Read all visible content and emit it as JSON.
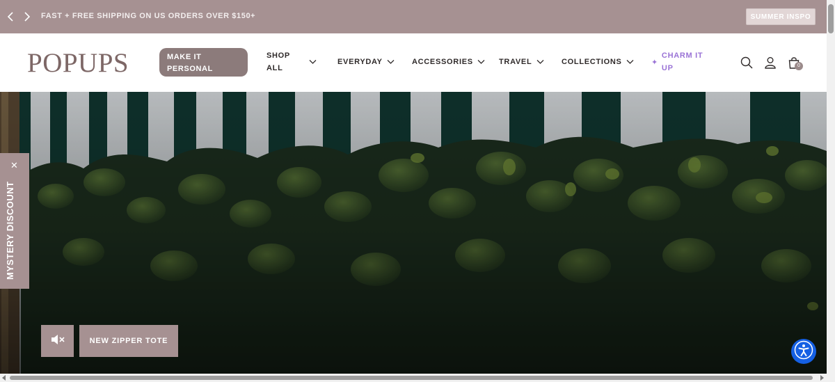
{
  "announcement": {
    "message": "FAST + FREE SHIPPING ON US ORDERS OVER $150+",
    "prev_icon": "chevron-left-icon",
    "next_icon": "chevron-right-icon",
    "cta_label": "SUMMER INSPO",
    "bg_color": "#a69192"
  },
  "header": {
    "logo": "POPUPS",
    "personal_label": "MAKE IT PERSONAL",
    "nav": [
      {
        "label": "SHOP ALL"
      },
      {
        "label": "EVERYDAY"
      },
      {
        "label": "ACCESSORIES"
      },
      {
        "label": "TRAVEL"
      },
      {
        "label": "COLLECTIONS"
      }
    ],
    "charm_label": "CHARM IT UP",
    "charm_color": "#9a73d6",
    "icons": [
      "search-icon",
      "account-icon",
      "cart-icon"
    ],
    "cart_count": "0"
  },
  "hero": {
    "mystery_label": "MYSTERY DISCOUNT",
    "mute_icon": "speaker-muted-icon",
    "tote_label": "NEW ZIPPER TOTE",
    "accessibility_icon": "accessibility-icon",
    "accessibility_color": "#1560e4"
  }
}
